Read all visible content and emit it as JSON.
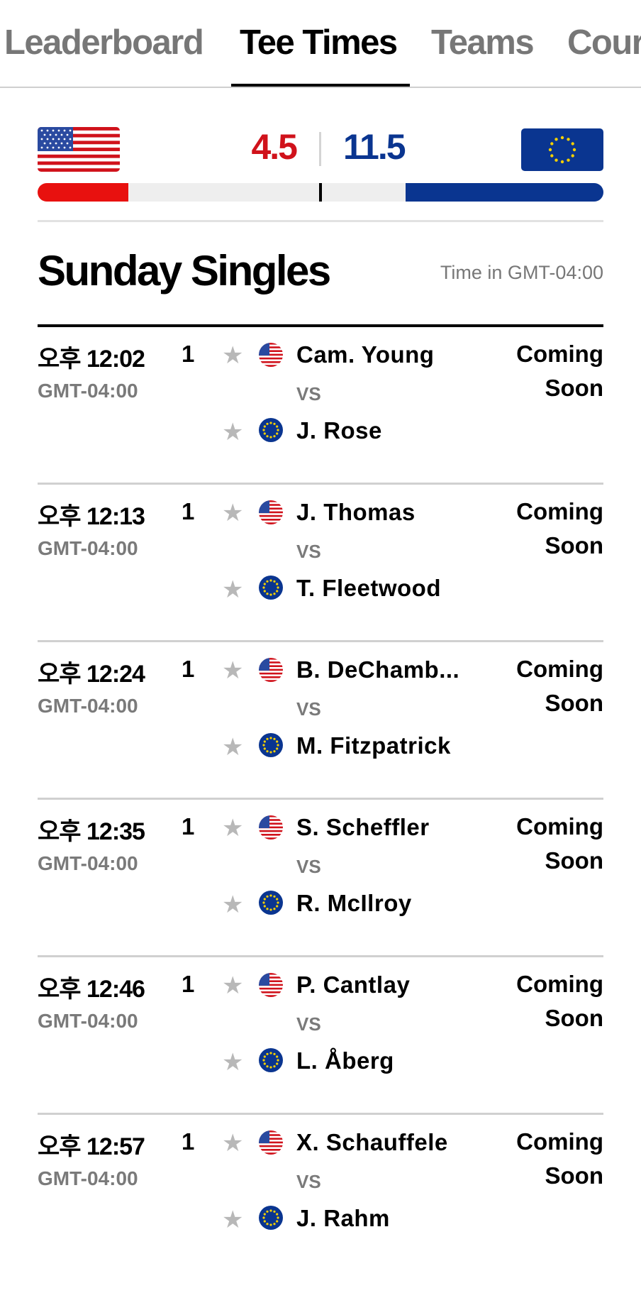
{
  "tabs": [
    {
      "label": "Leaderboard"
    },
    {
      "label": "Tee Times"
    },
    {
      "label": "Teams"
    },
    {
      "label": "Cour"
    }
  ],
  "score": {
    "us": "4.5",
    "eu": "11.5",
    "us_fraction": 0.16,
    "eu_fraction": 0.35,
    "us_color": "#e8110f",
    "eu_color": "#0a3590"
  },
  "section": {
    "title": "Sunday Singles",
    "timezone_note": "Time in GMT-04:00"
  },
  "matches": [
    {
      "time": "오후 12:02",
      "tz": "GMT-04:00",
      "num": "1",
      "player_us": "Cam. Young",
      "vs": "VS",
      "player_eu": "J. Rose",
      "status": "Coming Soon"
    },
    {
      "time": "오후 12:13",
      "tz": "GMT-04:00",
      "num": "1",
      "player_us": "J. Thomas",
      "vs": "VS",
      "player_eu": "T. Fleetwood",
      "status": "Coming Soon"
    },
    {
      "time": "오후 12:24",
      "tz": "GMT-04:00",
      "num": "1",
      "player_us": "B. DeChamb...",
      "vs": "VS",
      "player_eu": "M. Fitzpatrick",
      "status": "Coming Soon"
    },
    {
      "time": "오후 12:35",
      "tz": "GMT-04:00",
      "num": "1",
      "player_us": "S. Scheffler",
      "vs": "VS",
      "player_eu": "R. McIlroy",
      "status": "Coming Soon"
    },
    {
      "time": "오후 12:46",
      "tz": "GMT-04:00",
      "num": "1",
      "player_us": "P. Cantlay",
      "vs": "VS",
      "player_eu": "L. Åberg",
      "status": "Coming Soon"
    },
    {
      "time": "오후 12:57",
      "tz": "GMT-04:00",
      "num": "1",
      "player_us": "X. Schauffele",
      "vs": "VS",
      "player_eu": "J. Rahm",
      "status": "Coming Soon"
    }
  ],
  "icons": {
    "favorite": "star-icon",
    "team_us": "us-flag-icon",
    "team_eu": "eu-flag-icon"
  }
}
